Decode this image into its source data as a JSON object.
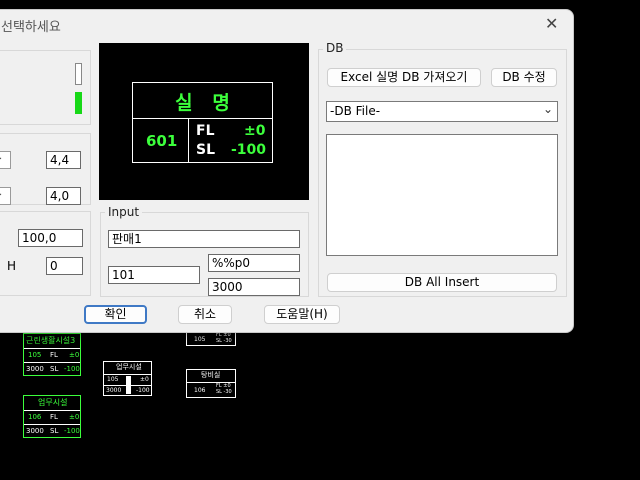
{
  "dialog": {
    "title": "선택하세요",
    "close_glyph": "✕"
  },
  "left_panel": {
    "combo1_value": "4,4",
    "combo2_value": "4,0",
    "field1_value": "100,0",
    "field2_label": "H",
    "field2_value": "0"
  },
  "preview": {
    "title": "실   명",
    "number": "601",
    "fl_label": "FL",
    "fl_value": "±0",
    "sl_label": "SL",
    "sl_value": "-100"
  },
  "input_group": {
    "label": "Input",
    "name_value": "판매1",
    "number_value": "101",
    "fl_value": "%%p0",
    "sl_value": "3000"
  },
  "db_group": {
    "label": "DB",
    "excel_button": "Excel 실명 DB 가져오기",
    "edit_button": "DB 수정",
    "file_select": "-DB File-",
    "insert_all_button": "DB All Insert"
  },
  "footer": {
    "ok_button": "확인",
    "cancel_button": "취소",
    "help_button": "도움말(H)"
  },
  "cad_background": {
    "block1": {
      "title": "근린생활시설3",
      "num": "105",
      "fl": "FL",
      "fl_val": "±0",
      "sl_num": "3000",
      "sl": "SL",
      "sl_val": "-100"
    },
    "block2": {
      "title": "업무시설",
      "num": "106",
      "fl": "FL",
      "fl_val": "±0",
      "sl_num": "3000",
      "sl": "SL",
      "sl_val": "-100"
    },
    "block3": {
      "title": "업무시설",
      "num": "105",
      "fl_val": "±0",
      "sl_num": "3000",
      "sl_val": "-100"
    },
    "block4": {
      "title": "탕비실",
      "num": "106",
      "fl": "FL ±0",
      "sl": "SL -30"
    },
    "block5": {
      "num": "105",
      "fl": "FL ±0",
      "sl": "SL -30"
    }
  }
}
